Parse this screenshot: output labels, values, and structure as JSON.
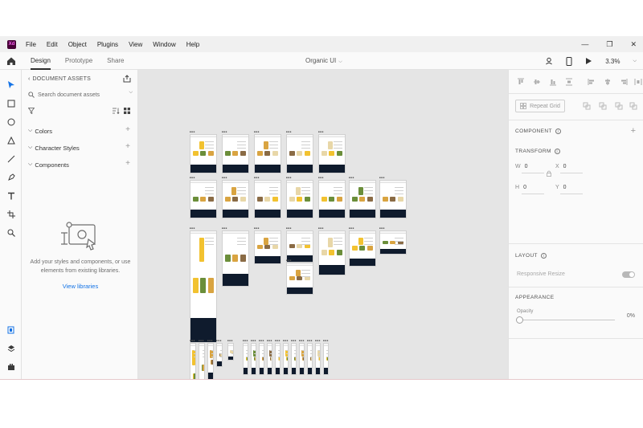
{
  "menubar": {
    "logo_text": "Xd",
    "items": [
      "File",
      "Edit",
      "Object",
      "Plugins",
      "View",
      "Window",
      "Help"
    ],
    "window_controls": [
      "—",
      "❐",
      "✕"
    ]
  },
  "toolbar": {
    "tabs": [
      "Design",
      "Prototype",
      "Share"
    ],
    "active_tab": "Design",
    "document_title": "Organic UI",
    "zoom": "3.3%"
  },
  "assets": {
    "header": "DOCUMENT ASSETS",
    "search_placeholder": "Search document assets",
    "sections": [
      "Colors",
      "Character Styles",
      "Components"
    ],
    "empty_text": "Add your styles and components, or use elements from existing libraries.",
    "view_libraries": "View libraries"
  },
  "properties": {
    "repeat_grid": "Repeat Grid",
    "component_label": "COMPONENT",
    "transform_label": "TRANSFORM",
    "w_label": "W",
    "w_value": "0",
    "x_label": "X",
    "x_value": "0",
    "h_label": "H",
    "h_value": "0",
    "y_label": "Y",
    "y_value": "0",
    "layout_label": "LAYOUT",
    "responsive_resize": "Responsive Resize",
    "responsive_resize_on": true,
    "appearance_label": "APPEARANCE",
    "opacity_label": "Opacity",
    "opacity_value": "0%"
  },
  "colors": {
    "accent": "#1473e6",
    "footer_dark": "#0f1b2d",
    "product_yellow": "#f2c230",
    "product_green": "#6b8e3a"
  }
}
